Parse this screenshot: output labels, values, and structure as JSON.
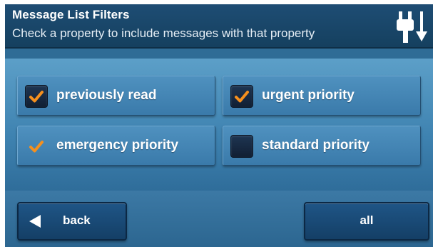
{
  "header": {
    "title": "Message List Filters",
    "subtitle": "Check a property to include messages with that property",
    "icon": "plug-arrow-icon"
  },
  "filters": [
    {
      "label": "previously read",
      "checked": true,
      "checkbox_visible": true
    },
    {
      "label": "urgent priority",
      "checked": true,
      "checkbox_visible": true
    },
    {
      "label": "emergency priority",
      "checked": true,
      "checkbox_visible": false
    },
    {
      "label": "standard priority",
      "checked": false,
      "checkbox_visible": true
    }
  ],
  "footer": {
    "back_label": "back",
    "back_icon": "back-arrow-icon",
    "all_label": "all"
  },
  "colors": {
    "check": "#f5901e",
    "header": "#1e4d74",
    "panel": "#4a8cbc"
  }
}
